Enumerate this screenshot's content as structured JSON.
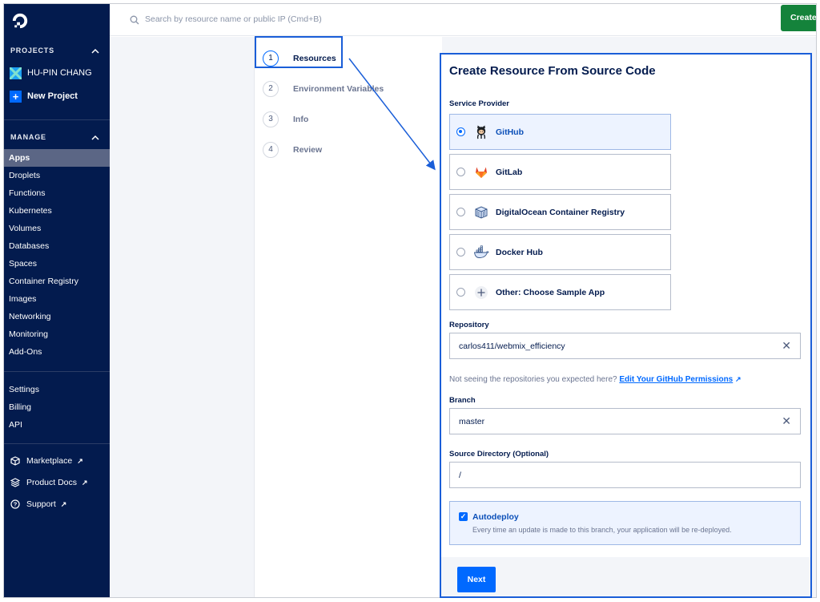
{
  "sidebar": {
    "projects_heading": "PROJECTS",
    "project_name": "HU-PIN CHANG",
    "new_project_label": "New Project",
    "manage_heading": "MANAGE",
    "manage_items": [
      "Apps",
      "Droplets",
      "Functions",
      "Kubernetes",
      "Volumes",
      "Databases",
      "Spaces",
      "Container Registry",
      "Images",
      "Networking",
      "Monitoring",
      "Add-Ons"
    ],
    "active_item": "Apps",
    "account_items": [
      "Settings",
      "Billing",
      "API"
    ],
    "external_links": [
      {
        "label": "Marketplace",
        "icon": "box-icon"
      },
      {
        "label": "Product Docs",
        "icon": "layers-icon"
      },
      {
        "label": "Support",
        "icon": "help-icon"
      }
    ],
    "external_arrow": "↗"
  },
  "topbar": {
    "search_placeholder": "Search by resource name or public IP (Cmd+B)",
    "create_label": "Create"
  },
  "steps": [
    {
      "num": "1",
      "label": "Resources",
      "active": true
    },
    {
      "num": "2",
      "label": "Environment Variables",
      "active": false
    },
    {
      "num": "3",
      "label": "Info",
      "active": false
    },
    {
      "num": "4",
      "label": "Review",
      "active": false
    }
  ],
  "form": {
    "title": "Create Resource From Source Code",
    "service_provider_label": "Service Provider",
    "providers": [
      {
        "label": "GitHub",
        "icon": "github-icon",
        "selected": true
      },
      {
        "label": "GitLab",
        "icon": "gitlab-icon",
        "selected": false
      },
      {
        "label": "DigitalOcean Container Registry",
        "icon": "container-registry-icon",
        "selected": false
      },
      {
        "label": "Docker Hub",
        "icon": "docker-icon",
        "selected": false
      },
      {
        "label": "Other: Choose Sample App",
        "icon": "plus-icon",
        "selected": false
      }
    ],
    "repository_label": "Repository",
    "repository_value": "carlos411/webmix_efficiency",
    "repo_hint": "Not seeing the repositories you expected here?",
    "repo_hint_link": "Edit Your GitHub Permissions",
    "branch_label": "Branch",
    "branch_value": "master",
    "source_dir_label": "Source Directory (Optional)",
    "source_dir_value": "/",
    "autodeploy_label": "Autodeploy",
    "autodeploy_checked": true,
    "autodeploy_desc": "Every time an update is made to this branch, your application will be re-deployed.",
    "next_label": "Next",
    "clear_glyph": "✕"
  },
  "colors": {
    "sidebar_bg": "#031b4e",
    "accent": "#0069ff",
    "create_green": "#14833b",
    "annotation_blue": "#1a5ed8"
  }
}
